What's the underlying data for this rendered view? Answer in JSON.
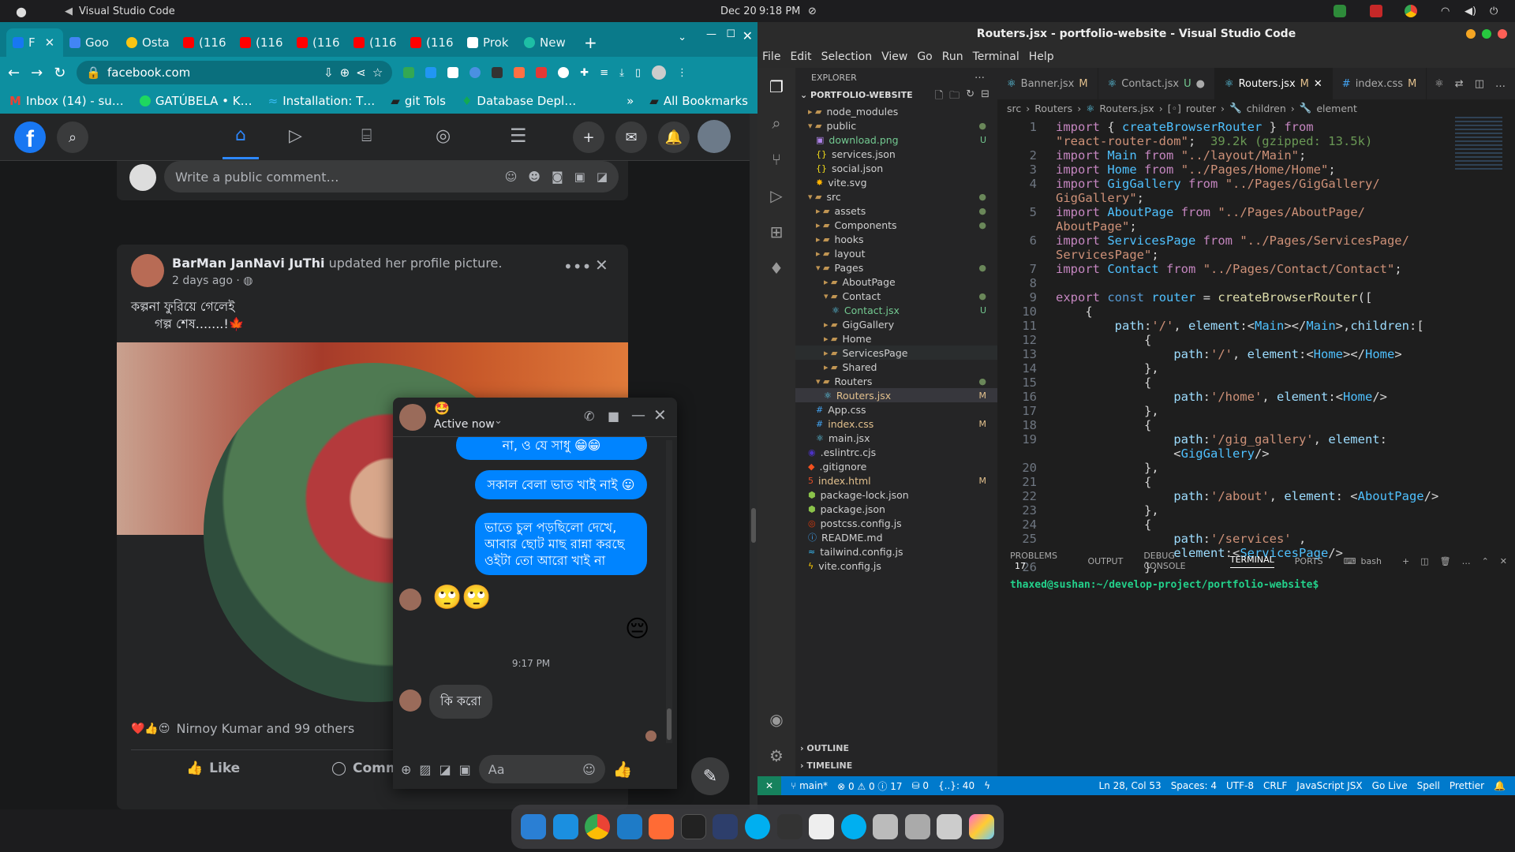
{
  "topbar": {
    "apple": "",
    "app": "Visual Studio Code",
    "date": "Dec 20",
    "time": "9:18 PM"
  },
  "chrome": {
    "tabs": [
      {
        "label": "F"
      },
      {
        "label": "Goo"
      },
      {
        "label": "Osta"
      },
      {
        "label": "(116"
      },
      {
        "label": "(116"
      },
      {
        "label": "(116"
      },
      {
        "label": "(116"
      },
      {
        "label": "(116"
      },
      {
        "label": "Prok"
      },
      {
        "label": "New"
      }
    ],
    "url": "facebook.com",
    "bookmarks": [
      "Inbox (14) - su…",
      "GATÚBELA • K…",
      "Installation: T…",
      "git Tols",
      "Database Depl…"
    ],
    "bookmarks_more": "»",
    "all_bookmarks": "All Bookmarks"
  },
  "facebook": {
    "comment_placeholder": "Write a public comment…",
    "post": {
      "author": "BarMan JanNavi JuThi",
      "action": "updated her profile picture.",
      "time": "2 days ago ·",
      "text_line1": "কল্পনা ফুরিয়ে গেলেই",
      "text_line2": "গল্প শেষ.......!🍁",
      "reactions": "Nirnoy Kumar and 99 others",
      "like": "Like",
      "comment": "Comm"
    }
  },
  "messenger": {
    "emoji": "🤩",
    "status": "Active now",
    "messages": [
      {
        "text": "না, ও যে সাধু 😁😁"
      },
      {
        "text": "সকাল বেলা ভাত খাই নাই 😛"
      },
      {
        "text": "ভাতে চুল পড়ছিলো দেখে,\nআবার ছোট মাছ রান্না করছে\nওইটা তো আরো খাই না"
      }
    ],
    "received_emoji": "🙄🙄",
    "sent_emoji": "😔",
    "timestamp": "9:17 PM",
    "received_text": "কি করো",
    "input_placeholder": "Aa"
  },
  "vscode": {
    "title": "Routers.jsx - portfolio-website - Visual Studio Code",
    "menu": [
      "File",
      "Edit",
      "Selection",
      "View",
      "Go",
      "Run",
      "Terminal",
      "Help"
    ],
    "explorer_label": "EXPLORER",
    "project": "PORTFOLIO-WEBSITE",
    "tree": [
      {
        "label": "node_modules",
        "depth": 1,
        "type": "folder",
        "badge": ""
      },
      {
        "label": "public",
        "depth": 1,
        "type": "folder-open",
        "badge": "●"
      },
      {
        "label": "download.png",
        "depth": 2,
        "type": "file",
        "badge": "U"
      },
      {
        "label": "services.json",
        "depth": 2,
        "type": "json",
        "badge": ""
      },
      {
        "label": "social.json",
        "depth": 2,
        "type": "json",
        "badge": ""
      },
      {
        "label": "vite.svg",
        "depth": 2,
        "type": "svg",
        "badge": ""
      },
      {
        "label": "src",
        "depth": 1,
        "type": "folder-open",
        "badge": "●"
      },
      {
        "label": "assets",
        "depth": 2,
        "type": "folder",
        "badge": "●"
      },
      {
        "label": "Components",
        "depth": 2,
        "type": "folder",
        "badge": "●"
      },
      {
        "label": "hooks",
        "depth": 2,
        "type": "folder",
        "badge": ""
      },
      {
        "label": "layout",
        "depth": 2,
        "type": "folder",
        "badge": ""
      },
      {
        "label": "Pages",
        "depth": 2,
        "type": "folder-open",
        "badge": "●"
      },
      {
        "label": "AboutPage",
        "depth": 3,
        "type": "folder",
        "badge": ""
      },
      {
        "label": "Contact",
        "depth": 3,
        "type": "folder-open",
        "badge": "●"
      },
      {
        "label": "Contact.jsx",
        "depth": 4,
        "type": "react",
        "badge": "U"
      },
      {
        "label": "GigGallery",
        "depth": 3,
        "type": "folder",
        "badge": ""
      },
      {
        "label": "Home",
        "depth": 3,
        "type": "folder",
        "badge": ""
      },
      {
        "label": "ServicesPage",
        "depth": 3,
        "type": "folder",
        "badge": ""
      },
      {
        "label": "Shared",
        "depth": 3,
        "type": "folder",
        "badge": ""
      },
      {
        "label": "Routers",
        "depth": 2,
        "type": "folder-open",
        "badge": "●"
      },
      {
        "label": "Routers.jsx",
        "depth": 3,
        "type": "react",
        "badge": "M"
      },
      {
        "label": "App.css",
        "depth": 2,
        "type": "css",
        "badge": ""
      },
      {
        "label": "index.css",
        "depth": 2,
        "type": "css",
        "badge": "M"
      },
      {
        "label": "main.jsx",
        "depth": 2,
        "type": "react",
        "badge": ""
      },
      {
        "label": ".eslintrc.cjs",
        "depth": 1,
        "type": "eslint",
        "badge": ""
      },
      {
        "label": ".gitignore",
        "depth": 1,
        "type": "git",
        "badge": ""
      },
      {
        "label": "index.html",
        "depth": 1,
        "type": "html",
        "badge": "M"
      },
      {
        "label": "package-lock.json",
        "depth": 1,
        "type": "npm",
        "badge": ""
      },
      {
        "label": "package.json",
        "depth": 1,
        "type": "npm",
        "badge": ""
      },
      {
        "label": "postcss.config.js",
        "depth": 1,
        "type": "postcss",
        "badge": ""
      },
      {
        "label": "README.md",
        "depth": 1,
        "type": "info",
        "badge": ""
      },
      {
        "label": "tailwind.config.js",
        "depth": 1,
        "type": "tailwind",
        "badge": ""
      },
      {
        "label": "vite.config.js",
        "depth": 1,
        "type": "vite",
        "badge": ""
      }
    ],
    "outline": "OUTLINE",
    "timeline": "TIMELINE",
    "tabs": [
      {
        "label": "Banner.jsx",
        "mark": "M"
      },
      {
        "label": "Contact.jsx",
        "mark": "U"
      },
      {
        "label": "Routers.jsx",
        "mark": "M"
      },
      {
        "label": "index.css",
        "mark": "M"
      }
    ],
    "breadcrumb": [
      "src",
      "Routers",
      "Routers.jsx",
      "router",
      "children",
      "element"
    ],
    "code": [
      {
        "n": "1",
        "h": "<span class=kw>import</span> { <span class=vr>createBrowserRouter</span> } <span class=kw>from</span>"
      },
      {
        "n": "",
        "h": "<span class=st>\"react-router-dom\"</span>;  <span style=\"color:#6a9955\">39.2k (gzipped: 13.5k)</span>"
      },
      {
        "n": "2",
        "h": "<span class=kw>import</span> <span class=vr>Main</span> <span class=kw>from</span> <span class=st>\"../layout/Main\"</span>;"
      },
      {
        "n": "3",
        "h": "<span class=kw>import</span> <span class=vr>Home</span> <span class=kw>from</span> <span class=st>\"../Pages/Home/Home\"</span>;"
      },
      {
        "n": "4",
        "h": "<span class=kw>import</span> <span class=vr>GigGallery</span> <span class=kw>from</span> <span class=st>\"../Pages/GigGallery/</span>"
      },
      {
        "n": "",
        "h": "<span class=st>GigGallery\"</span>;"
      },
      {
        "n": "5",
        "h": "<span class=kw>import</span> <span class=vr>AboutPage</span> <span class=kw>from</span> <span class=st>\"../Pages/AboutPage/</span>"
      },
      {
        "n": "",
        "h": "<span class=st>AboutPage\"</span>;"
      },
      {
        "n": "6",
        "h": "<span class=kw>import</span> <span class=vr>ServicesPage</span> <span class=kw>from</span> <span class=st>\"../Pages/ServicesPage/</span>"
      },
      {
        "n": "",
        "h": "<span class=st>ServicesPage\"</span>;"
      },
      {
        "n": "7",
        "h": "<span class=kw>import</span> <span class=vr>Contact</span> <span class=kw>from</span> <span class=st>\"../Pages/Contact/Contact\"</span>;"
      },
      {
        "n": "8",
        "h": ""
      },
      {
        "n": "9",
        "h": "<span class=kw>export</span> <span class=tg>const</span> <span class=vr>router</span> = <span class=fn>createBrowserRouter</span>(["
      },
      {
        "n": "10",
        "h": "    {"
      },
      {
        "n": "11",
        "h": "        <span class=ky>path</span>:<span class=st>'/'</span>, <span class=ky>element</span>:&lt;<span class=vr>Main</span>&gt;&lt;/<span class=vr>Main</span>&gt;,<span class=ky>children</span>:["
      },
      {
        "n": "12",
        "h": "            {"
      },
      {
        "n": "13",
        "h": "                <span class=ky>path</span>:<span class=st>'/'</span>, <span class=ky>element</span>:&lt;<span class=vr>Home</span>&gt;&lt;/<span class=vr>Home</span>&gt;"
      },
      {
        "n": "14",
        "h": "            },"
      },
      {
        "n": "15",
        "h": "            {"
      },
      {
        "n": "16",
        "h": "                <span class=ky>path</span>:<span class=st>'/home'</span>, <span class=ky>element</span>:&lt;<span class=vr>Home</span>/&gt;"
      },
      {
        "n": "17",
        "h": "            },"
      },
      {
        "n": "18",
        "h": "            {"
      },
      {
        "n": "19",
        "h": "                <span class=ky>path</span>:<span class=st>'/gig_gallery'</span>, <span class=ky>element</span>:"
      },
      {
        "n": "",
        "h": "                &lt;<span class=vr>GigGallery</span>/&gt;"
      },
      {
        "n": "20",
        "h": "            },"
      },
      {
        "n": "21",
        "h": "            {"
      },
      {
        "n": "22",
        "h": "                <span class=ky>path</span>:<span class=st>'/about'</span>, <span class=ky>element</span>: &lt;<span class=vr>AboutPage</span>/&gt;"
      },
      {
        "n": "23",
        "h": "            },"
      },
      {
        "n": "24",
        "h": "            {"
      },
      {
        "n": "25",
        "h": "                <span class=ky>path</span>:<span class=st>'/services'</span> ,"
      },
      {
        "n": "",
        "h": "                <span class=ky>element</span>:&lt;<span class=vr>ServicesPage</span>/&gt;"
      },
      {
        "n": "26",
        "h": "            },"
      }
    ],
    "panel_tabs": [
      {
        "label": "PROBLEMS",
        "count": "17"
      },
      {
        "label": "OUTPUT"
      },
      {
        "label": "DEBUG CONSOLE"
      },
      {
        "label": "TERMINAL"
      },
      {
        "label": "PORTS"
      }
    ],
    "shell": "bash",
    "terminal_prompt": "thaxed@sushan:~/develop-project/portfolio-website$",
    "status": {
      "branch": "main*",
      "errors": "0",
      "warnings": "0",
      "info": "17",
      "ports": "0",
      "lines": "{..}: 40",
      "pos": "Ln 28, Col 53",
      "spaces": "Spaces: 4",
      "enc": "UTF-8",
      "eol": "CRLF",
      "lang": "JavaScript JSX",
      "golive": "Go Live",
      "spell": "Spell",
      "prettier": "Prettier"
    }
  }
}
